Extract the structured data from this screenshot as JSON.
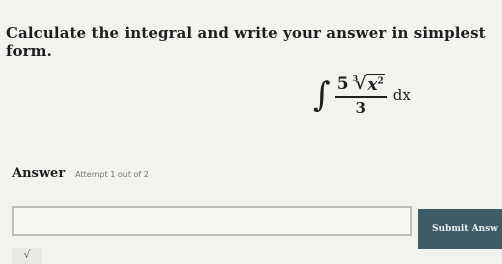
{
  "question": {
    "prompt": "Calculate the integral and write your answer in simplest form."
  },
  "integral": {
    "sign": "∫",
    "coefficient": "5",
    "root_index": "3",
    "radicand_base": "x",
    "radicand_exponent": "2",
    "denominator": "3",
    "differential": "dx"
  },
  "answer": {
    "label": "Answer",
    "attempt_text": "Attempt 1 out of 2",
    "input_value": "",
    "submit_label": "Submit Answ",
    "sqrt_tool_label": "√"
  }
}
